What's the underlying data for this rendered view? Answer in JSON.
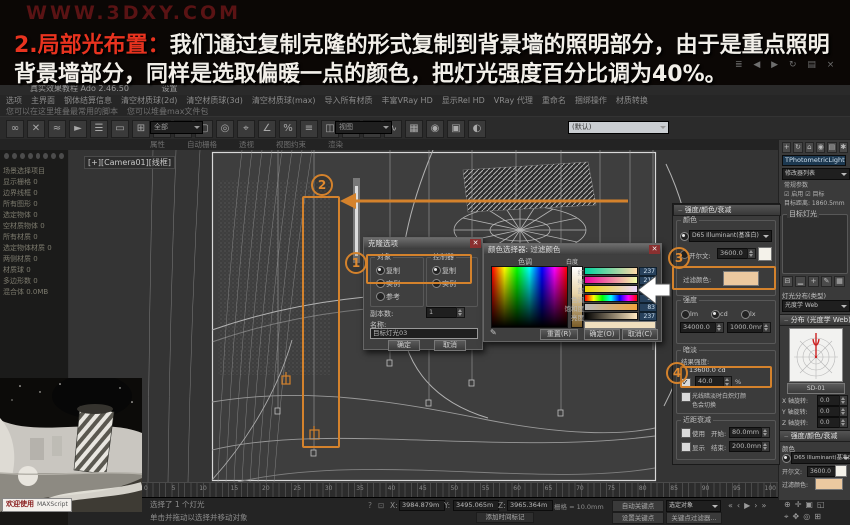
{
  "banner": {
    "watermark": "WWW.3DXY.COM",
    "heading_prefix": "2.局部光布置：",
    "heading_line1": "我们通过复制克隆的形式复制到背景墙的照明部分，由于是重点照明",
    "heading_line2": "背景墙部分，同样是选取偏暖一点的颜色，把灯光强度百分比调为40%。",
    "accent_color": "#e8331f",
    "corner_icons": "≣ ◀ ▶ ↻ ▤ ×"
  },
  "window": {
    "title": "真实效果教程 Ado 2.46.50",
    "settings": "设置"
  },
  "menubar": {
    "row1": [
      "选项",
      "主界面",
      "钢体结算信息",
      "清空材质球(2d)",
      "清空材质球(3d)",
      "清空材质球(max)",
      "导入所有材质",
      "丰富VRay HD",
      "显示Rel HD",
      "VRay 代理",
      "重命名",
      "捆绑操作",
      "材质转换"
    ],
    "row2": [
      "您可以在这里堆叠最常用的脚本",
      "您可以堆叠max文件包"
    ]
  },
  "toolbar": {
    "icons": [
      {
        "name": "select-link-icon",
        "glyph": "∞"
      },
      {
        "name": "unlink-icon",
        "glyph": "✕"
      },
      {
        "name": "bind-spacewarp-icon",
        "glyph": "≈"
      },
      {
        "name": "select-object-icon",
        "glyph": "►"
      },
      {
        "name": "select-by-name-icon",
        "glyph": "☰"
      },
      {
        "name": "region-select-icon",
        "glyph": "▭"
      },
      {
        "name": "window-crossing-icon",
        "glyph": "⊞"
      },
      {
        "name": "move-icon",
        "glyph": "✛"
      },
      {
        "name": "rotate-icon",
        "glyph": "↻"
      },
      {
        "name": "scale-icon",
        "glyph": "▢"
      },
      {
        "name": "use-pivot-icon",
        "glyph": "◎"
      },
      {
        "name": "snap-toggle-icon",
        "glyph": "⌖"
      },
      {
        "name": "angle-snap-icon",
        "glyph": "∠"
      },
      {
        "name": "percent-snap-icon",
        "glyph": "%"
      },
      {
        "name": "spinner-snap-icon",
        "glyph": "≡"
      },
      {
        "name": "mirror-icon",
        "glyph": "◫"
      },
      {
        "name": "align-icon",
        "glyph": "∥"
      },
      {
        "name": "layer-manager-icon",
        "glyph": "▥"
      },
      {
        "name": "curve-editor-icon",
        "glyph": "∿"
      },
      {
        "name": "schematic-view-icon",
        "glyph": "▦"
      },
      {
        "name": "material-editor-icon",
        "glyph": "◉"
      },
      {
        "name": "render-setup-icon",
        "glyph": "▣"
      },
      {
        "name": "render-icon",
        "glyph": "◐"
      }
    ],
    "filter_combo": "全部",
    "coordsys_combo": "视图",
    "named_sel_combo": "(默认)"
  },
  "subtoolbar": [
    "属性",
    "自动栅格",
    "透视",
    "视图约束",
    "渲染"
  ],
  "left_panel": {
    "items": [
      "场景选择项目",
      "显示栅格 0",
      "边界线框 0",
      "所有图形 0",
      "选定物体 0",
      "空材质物体 0",
      "所有材质 0",
      "选定物体材质 0",
      "两侧材质 0",
      "材质球 0",
      "多边形数 0",
      "混合体 0.0MB"
    ]
  },
  "viewport": {
    "label": "[+][Camera01][线框]"
  },
  "clone_dialog": {
    "title": "克隆选项",
    "object_group": "对象",
    "controller_group": "控制器",
    "object_options": [
      "复制",
      "实例",
      "参考"
    ],
    "controller_options": [
      "复制",
      "实例"
    ],
    "copies_label": "副本数:",
    "copies_value": "1",
    "name_label": "名称:",
    "name_value": "目标灯光03",
    "ok": "确定",
    "cancel": "取消"
  },
  "color_dialog": {
    "title": "颜色选择器: 过滤颜色",
    "hue_label": "色调",
    "whiteness_label": "白度",
    "channels": [
      {
        "label": "红",
        "value": "237"
      },
      {
        "label": "绿",
        "value": "212"
      },
      {
        "label": "蓝",
        "value": "160"
      },
      {
        "label": "色调",
        "value": "36"
      },
      {
        "label": "饱和度",
        "value": "83"
      },
      {
        "label": "亮度",
        "value": "237"
      }
    ],
    "swatch_color": "#f0dfbe",
    "reset": "重置(R)",
    "ok": "确定(O)",
    "cancel": "取消(C)"
  },
  "intensity_panel": {
    "header": "强度/颜色/衰减",
    "color_group": "颜色",
    "preset": "D65 Illuminant(基准白)",
    "kelvin_label": "开尔文:",
    "kelvin_value": "3600.0",
    "filter_label": "过滤颜色:",
    "filter_color": "#ecc9a0",
    "intensity_group": "强度",
    "unit_lm": "lm",
    "unit_cd": "cd",
    "unit_lx": "lx",
    "intensity_value": "34000.0",
    "lx_distance": "1000.0mm",
    "dim_group": "暗淡",
    "result_label": "结果强度:",
    "result_value": "13600.0 cd",
    "dim_value": "40.0",
    "percent": "%",
    "incandescent_line1": "光线暗淡时白炽灯颜",
    "incandescent_line2": "色会切换",
    "near_group": "近距衰减",
    "use_label": "使用",
    "start_label": "开始:",
    "start_value": "80.0mm",
    "show_label": "显示",
    "end_label": "结束:",
    "end_value": "200.0mm"
  },
  "command_panel": {
    "tabs": [
      {
        "name": "create-tab-icon",
        "glyph": "+"
      },
      {
        "name": "modify-tab-icon",
        "glyph": "↻"
      },
      {
        "name": "hierarchy-tab-icon",
        "glyph": "⌂"
      },
      {
        "name": "motion-tab-icon",
        "glyph": "◉"
      },
      {
        "name": "display-tab-icon",
        "glyph": "▤"
      },
      {
        "name": "utilities-tab-icon",
        "glyph": "✱"
      }
    ],
    "object_name": "TPhotometricLight02",
    "modifier_list": "修改器列表",
    "stack_rows": [
      "常规参数",
      "☑ 启用  ☑ 目标",
      "目标距离: 1860.5mm"
    ],
    "light_group_label": "目标灯光",
    "stack_buttons": [
      {
        "name": "pin-stack-icon",
        "glyph": "⊟"
      },
      {
        "name": "show-end-result-icon",
        "glyph": "▁"
      },
      {
        "name": "make-unique-icon",
        "glyph": "+"
      },
      {
        "name": "remove-modifier-icon",
        "glyph": "✎"
      },
      {
        "name": "configure-icon",
        "glyph": "▦"
      }
    ],
    "dist_label": "灯光分布(类型)",
    "dist_value": "光度学 Web",
    "web_header": "分布 (光度学 Web)",
    "web_file": "SD-01",
    "rot_x": "X 轴旋转:",
    "rot_y": "Y 轴旋转:",
    "rot_z": "Z 轴旋转:",
    "rot_value": "0.0",
    "intensity_header": "强度/颜色/衰减",
    "color_label": "颜色",
    "preset": "D65 Illuminant(基准白)",
    "kelvin_label": "开尔文:",
    "kelvin_value": "3600.0",
    "filter_label": "过滤颜色:"
  },
  "timeline": {
    "ticks": [
      "0",
      "5",
      "10",
      "15",
      "20",
      "25",
      "30",
      "35",
      "40",
      "45",
      "50",
      "55",
      "60",
      "65",
      "70",
      "75",
      "80",
      "85",
      "90",
      "95",
      "100"
    ]
  },
  "statusbar": {
    "welcome_cn": "欢迎使用",
    "welcome_en": "MAXScript",
    "selection_info": "选择了 1 个灯光",
    "prompt": "单击并拖动以选择并移动对象",
    "help_icon": "?",
    "lock_icon": "⊡",
    "x_label": "X:",
    "x_value": "3984.879m",
    "y_label": "Y:",
    "y_value": "3495.065m",
    "z_label": "Z:",
    "z_value": "3965.364m",
    "grid": "栅格 = 10.0mm",
    "add_time_tag": "添加时间标记",
    "auto_key": "自动关键点",
    "selected_mode": "选定对象",
    "set_key": "设置关键点",
    "key_filters": "关键点过滤器...",
    "playback": [
      {
        "name": "go-start-icon",
        "glyph": "«"
      },
      {
        "name": "prev-frame-icon",
        "glyph": "‹"
      },
      {
        "name": "play-icon",
        "glyph": "▶"
      },
      {
        "name": "next-frame-icon",
        "glyph": "›"
      },
      {
        "name": "go-end-icon",
        "glyph": "»"
      }
    ],
    "nav_row1": [
      {
        "name": "zoom-icon",
        "glyph": "⊕"
      },
      {
        "name": "zoom-all-icon",
        "glyph": "✛"
      },
      {
        "name": "zoom-extents-icon",
        "glyph": "▣"
      },
      {
        "name": "zoom-region-icon",
        "glyph": "◱"
      }
    ],
    "nav_row2": [
      {
        "name": "fov-icon",
        "glyph": "⌖"
      },
      {
        "name": "pan-icon",
        "glyph": "✥"
      },
      {
        "name": "orbit-icon",
        "glyph": "◎"
      },
      {
        "name": "maximize-viewport-icon",
        "glyph": "⊞"
      }
    ]
  },
  "annotations": {
    "step1": "1",
    "step2": "2",
    "step3": "3",
    "step4": "4",
    "highlight_color": "#d4822c"
  }
}
